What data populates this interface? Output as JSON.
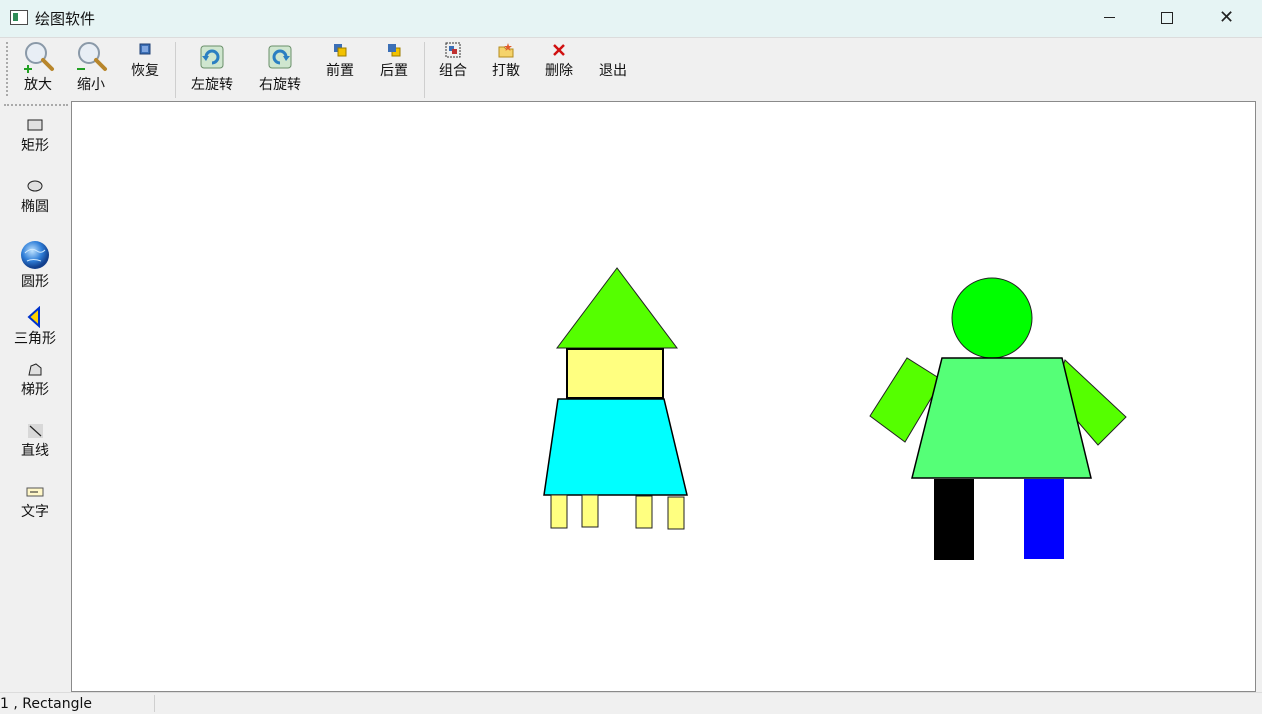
{
  "window": {
    "title": "绘图软件",
    "min_glyph": "",
    "close_glyph": "✕"
  },
  "toolbar": {
    "zoom_in": "放大",
    "zoom_out": "缩小",
    "restore": "恢复",
    "rotate_left": "左旋转",
    "rotate_right": "右旋转",
    "bring_front": "前置",
    "send_back": "后置",
    "group": "组合",
    "ungroup": "打散",
    "delete": "删除",
    "exit": "退出"
  },
  "sidebar": {
    "rect": "矩形",
    "ellipse": "椭圆",
    "circle": "圆形",
    "triangle": "三角形",
    "trapezoid": "梯形",
    "line": "直线",
    "text": "文字"
  },
  "colors": {
    "green": "#55ff00",
    "pale_yellow": "#ffff80",
    "cyan": "#00ffff",
    "bright_green": "#00ff00",
    "light_green": "#55ff77",
    "black": "#000000",
    "blue": "#0000ff"
  },
  "status": {
    "text": "1 , Rectangle"
  }
}
